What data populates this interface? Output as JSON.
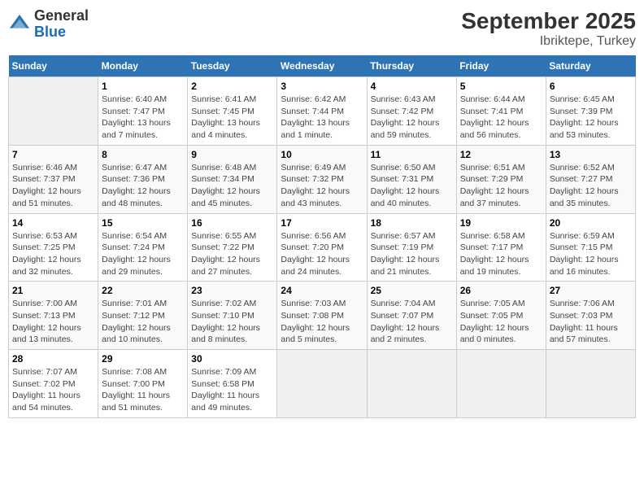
{
  "logo": {
    "general": "General",
    "blue": "Blue"
  },
  "title": "September 2025",
  "subtitle": "Ibriktepe, Turkey",
  "weekdays": [
    "Sunday",
    "Monday",
    "Tuesday",
    "Wednesday",
    "Thursday",
    "Friday",
    "Saturday"
  ],
  "weeks": [
    [
      {
        "empty": true
      },
      {
        "day": "1",
        "sunrise": "Sunrise: 6:40 AM",
        "sunset": "Sunset: 7:47 PM",
        "daylight": "Daylight: 13 hours and 7 minutes."
      },
      {
        "day": "2",
        "sunrise": "Sunrise: 6:41 AM",
        "sunset": "Sunset: 7:45 PM",
        "daylight": "Daylight: 13 hours and 4 minutes."
      },
      {
        "day": "3",
        "sunrise": "Sunrise: 6:42 AM",
        "sunset": "Sunset: 7:44 PM",
        "daylight": "Daylight: 13 hours and 1 minute."
      },
      {
        "day": "4",
        "sunrise": "Sunrise: 6:43 AM",
        "sunset": "Sunset: 7:42 PM",
        "daylight": "Daylight: 12 hours and 59 minutes."
      },
      {
        "day": "5",
        "sunrise": "Sunrise: 6:44 AM",
        "sunset": "Sunset: 7:41 PM",
        "daylight": "Daylight: 12 hours and 56 minutes."
      },
      {
        "day": "6",
        "sunrise": "Sunrise: 6:45 AM",
        "sunset": "Sunset: 7:39 PM",
        "daylight": "Daylight: 12 hours and 53 minutes."
      }
    ],
    [
      {
        "day": "7",
        "sunrise": "Sunrise: 6:46 AM",
        "sunset": "Sunset: 7:37 PM",
        "daylight": "Daylight: 12 hours and 51 minutes."
      },
      {
        "day": "8",
        "sunrise": "Sunrise: 6:47 AM",
        "sunset": "Sunset: 7:36 PM",
        "daylight": "Daylight: 12 hours and 48 minutes."
      },
      {
        "day": "9",
        "sunrise": "Sunrise: 6:48 AM",
        "sunset": "Sunset: 7:34 PM",
        "daylight": "Daylight: 12 hours and 45 minutes."
      },
      {
        "day": "10",
        "sunrise": "Sunrise: 6:49 AM",
        "sunset": "Sunset: 7:32 PM",
        "daylight": "Daylight: 12 hours and 43 minutes."
      },
      {
        "day": "11",
        "sunrise": "Sunrise: 6:50 AM",
        "sunset": "Sunset: 7:31 PM",
        "daylight": "Daylight: 12 hours and 40 minutes."
      },
      {
        "day": "12",
        "sunrise": "Sunrise: 6:51 AM",
        "sunset": "Sunset: 7:29 PM",
        "daylight": "Daylight: 12 hours and 37 minutes."
      },
      {
        "day": "13",
        "sunrise": "Sunrise: 6:52 AM",
        "sunset": "Sunset: 7:27 PM",
        "daylight": "Daylight: 12 hours and 35 minutes."
      }
    ],
    [
      {
        "day": "14",
        "sunrise": "Sunrise: 6:53 AM",
        "sunset": "Sunset: 7:25 PM",
        "daylight": "Daylight: 12 hours and 32 minutes."
      },
      {
        "day": "15",
        "sunrise": "Sunrise: 6:54 AM",
        "sunset": "Sunset: 7:24 PM",
        "daylight": "Daylight: 12 hours and 29 minutes."
      },
      {
        "day": "16",
        "sunrise": "Sunrise: 6:55 AM",
        "sunset": "Sunset: 7:22 PM",
        "daylight": "Daylight: 12 hours and 27 minutes."
      },
      {
        "day": "17",
        "sunrise": "Sunrise: 6:56 AM",
        "sunset": "Sunset: 7:20 PM",
        "daylight": "Daylight: 12 hours and 24 minutes."
      },
      {
        "day": "18",
        "sunrise": "Sunrise: 6:57 AM",
        "sunset": "Sunset: 7:19 PM",
        "daylight": "Daylight: 12 hours and 21 minutes."
      },
      {
        "day": "19",
        "sunrise": "Sunrise: 6:58 AM",
        "sunset": "Sunset: 7:17 PM",
        "daylight": "Daylight: 12 hours and 19 minutes."
      },
      {
        "day": "20",
        "sunrise": "Sunrise: 6:59 AM",
        "sunset": "Sunset: 7:15 PM",
        "daylight": "Daylight: 12 hours and 16 minutes."
      }
    ],
    [
      {
        "day": "21",
        "sunrise": "Sunrise: 7:00 AM",
        "sunset": "Sunset: 7:13 PM",
        "daylight": "Daylight: 12 hours and 13 minutes."
      },
      {
        "day": "22",
        "sunrise": "Sunrise: 7:01 AM",
        "sunset": "Sunset: 7:12 PM",
        "daylight": "Daylight: 12 hours and 10 minutes."
      },
      {
        "day": "23",
        "sunrise": "Sunrise: 7:02 AM",
        "sunset": "Sunset: 7:10 PM",
        "daylight": "Daylight: 12 hours and 8 minutes."
      },
      {
        "day": "24",
        "sunrise": "Sunrise: 7:03 AM",
        "sunset": "Sunset: 7:08 PM",
        "daylight": "Daylight: 12 hours and 5 minutes."
      },
      {
        "day": "25",
        "sunrise": "Sunrise: 7:04 AM",
        "sunset": "Sunset: 7:07 PM",
        "daylight": "Daylight: 12 hours and 2 minutes."
      },
      {
        "day": "26",
        "sunrise": "Sunrise: 7:05 AM",
        "sunset": "Sunset: 7:05 PM",
        "daylight": "Daylight: 12 hours and 0 minutes."
      },
      {
        "day": "27",
        "sunrise": "Sunrise: 7:06 AM",
        "sunset": "Sunset: 7:03 PM",
        "daylight": "Daylight: 11 hours and 57 minutes."
      }
    ],
    [
      {
        "day": "28",
        "sunrise": "Sunrise: 7:07 AM",
        "sunset": "Sunset: 7:02 PM",
        "daylight": "Daylight: 11 hours and 54 minutes."
      },
      {
        "day": "29",
        "sunrise": "Sunrise: 7:08 AM",
        "sunset": "Sunset: 7:00 PM",
        "daylight": "Daylight: 11 hours and 51 minutes."
      },
      {
        "day": "30",
        "sunrise": "Sunrise: 7:09 AM",
        "sunset": "Sunset: 6:58 PM",
        "daylight": "Daylight: 11 hours and 49 minutes."
      },
      {
        "empty": true
      },
      {
        "empty": true
      },
      {
        "empty": true
      },
      {
        "empty": true
      }
    ]
  ]
}
